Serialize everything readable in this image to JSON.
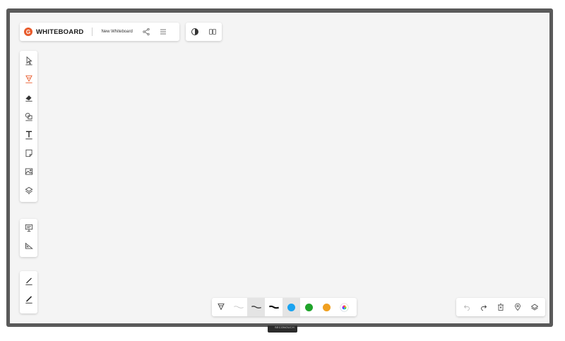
{
  "device": {
    "stand_label": "SECONOUCH",
    "brand_text": ""
  },
  "header": {
    "logo_letter": "G",
    "app_name": "WHITEBOARD",
    "board_name": "New Whiteboard"
  },
  "toolbar_left": {
    "tools": [
      "select-icon",
      "pen-icon",
      "eraser-icon",
      "shapes-icon",
      "text-icon",
      "sticky-note-icon",
      "image-icon",
      "stamp-icon"
    ],
    "tools2": [
      "presentation-icon",
      "ruler-icon"
    ],
    "tools3": [
      "pen-quick-icon",
      "marker-quick-icon"
    ]
  },
  "bottom_toolbar": {
    "active_index": 2,
    "colors": [
      "#1aa3f0",
      "#1fa32a",
      "#f0a020"
    ],
    "selected_color": "#1aa3f0"
  },
  "accent": "#e85a2a"
}
